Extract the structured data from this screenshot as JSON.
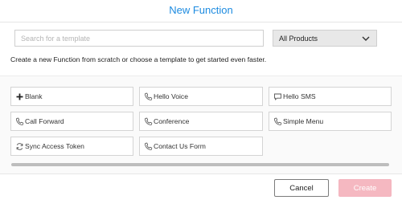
{
  "dialog": {
    "title": "New Function"
  },
  "search": {
    "placeholder": "Search for a template",
    "value": ""
  },
  "product_filter": {
    "selected": "All Products"
  },
  "intro_text": "Create a new Function from scratch or choose a template to get started even faster.",
  "templates": [
    {
      "label": "Blank",
      "icon": "plus-icon"
    },
    {
      "label": "Hello Voice",
      "icon": "phone-icon"
    },
    {
      "label": "Hello SMS",
      "icon": "chat-icon"
    },
    {
      "label": "Call Forward",
      "icon": "phone-icon"
    },
    {
      "label": "Conference",
      "icon": "phone-icon"
    },
    {
      "label": "Simple Menu",
      "icon": "phone-icon"
    },
    {
      "label": "Sync Access Token",
      "icon": "sync-icon"
    },
    {
      "label": "Contact Us Form",
      "icon": "phone-icon"
    }
  ],
  "footer": {
    "cancel_label": "Cancel",
    "create_label": "Create"
  },
  "colors": {
    "title": "#1d8be0",
    "create_disabled": "#f5b8c1"
  }
}
